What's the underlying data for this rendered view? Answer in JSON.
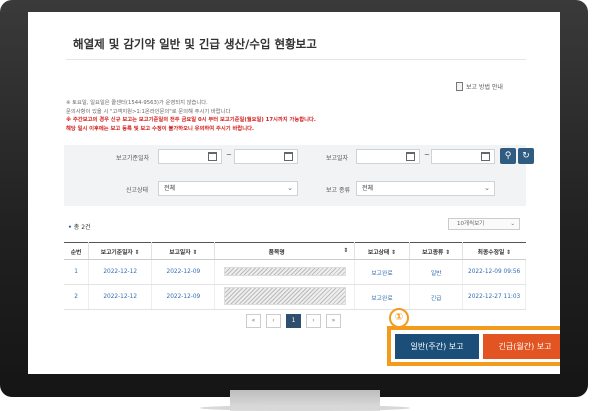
{
  "page": {
    "title": "해열제 및 감기약 일반 및 긴급 생산/수입 현황보고",
    "guide_link": "보고 방법 안내",
    "notices": [
      "※ 토요일, 일요일은 콜센터(1544-9563)가 운영되지 않습니다.",
      "문의사항이 있을 시 \"고객지원>1:1온라인문의\"로 문의해 주시기 바랍니다",
      "※ 주간보고의 경우 신규 보고는 보고기준일의 전주 금요일 0시 부터 보고기준일(월요일) 17시까지 가능합니다.",
      "해당 일시 이후에는 보고 등록 및 보고 수정이 불가하오니 유의하여 주시기 바랍니다."
    ]
  },
  "filter": {
    "base_date_label": "보고기준일자",
    "report_date_label": "보고일자",
    "status_label": "신고상태",
    "status_value": "전체",
    "type_label": "보고 종류",
    "type_value": "전체",
    "range_sep": "~",
    "search_icon": "search-icon",
    "reset_icon": "refresh-icon"
  },
  "list": {
    "count_prefix": "•",
    "count_text": "총 2건",
    "per_page": "10개씩보기",
    "columns": [
      "순번",
      "보고기준일자 ⇕",
      "보고일자 ⇕",
      "품목명",
      "⇕",
      "보고상태 ⇕",
      "보고종류 ⇕",
      "최종수정일 ⇕"
    ],
    "rows": [
      {
        "no": "1",
        "base_date": "2022-12-12",
        "report_date": "2022-12-09",
        "status": "보고완료",
        "type": "일반",
        "modified": "2022-12-09 09:56"
      },
      {
        "no": "2",
        "base_date": "2022-12-12",
        "report_date": "2022-12-09",
        "status": "보고완료",
        "type": "긴급",
        "modified": "2022-12-27 11:03"
      }
    ]
  },
  "pagination": {
    "first": "«",
    "prev": "‹",
    "current": "1",
    "next": "›",
    "last": "»"
  },
  "callout": {
    "marker": "①"
  },
  "actions": {
    "normal_report": "일반(주간) 보고",
    "urgent_report": "긴급(월간) 보고"
  },
  "colors": {
    "accent": "#1b4f7a",
    "urgent": "#e25522",
    "highlight": "#f29b1d"
  }
}
